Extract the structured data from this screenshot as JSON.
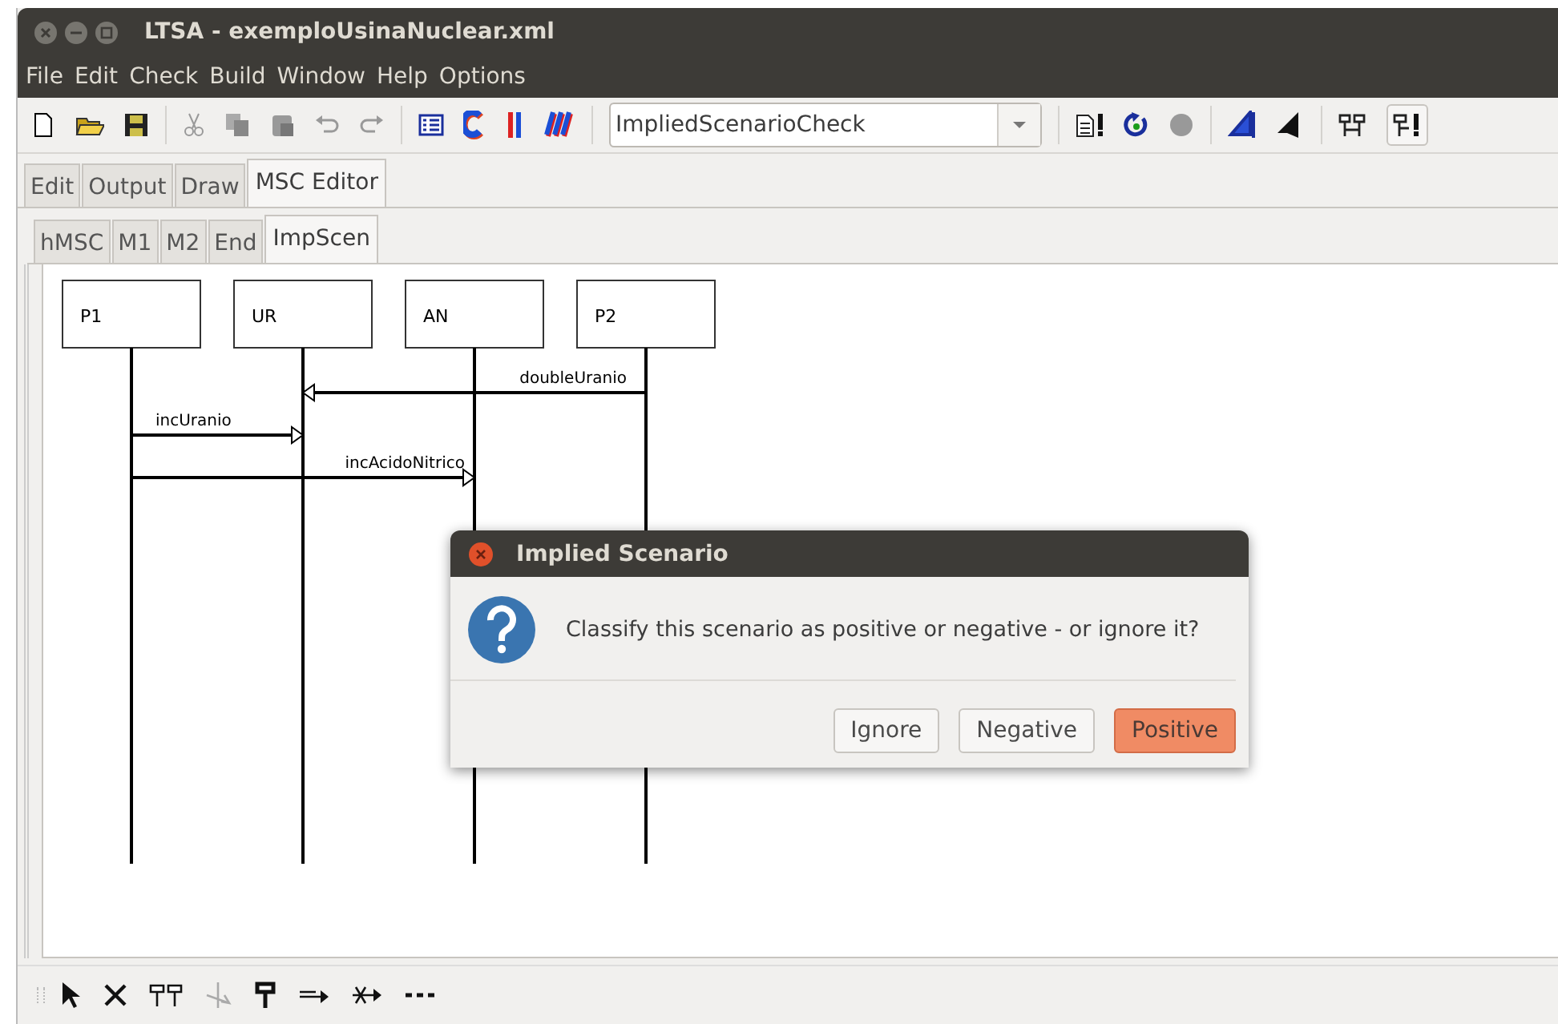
{
  "window": {
    "title": "LTSA - exemploUsinaNuclear.xml"
  },
  "menu": [
    "File",
    "Edit",
    "Check",
    "Build",
    "Window",
    "Help",
    "Options"
  ],
  "toolbar": {
    "target": "ImpliedScenarioCheck"
  },
  "tabs": [
    {
      "label": "Edit",
      "selected": false
    },
    {
      "label": "Output",
      "selected": false
    },
    {
      "label": "Draw",
      "selected": false
    },
    {
      "label": "MSC Editor",
      "selected": true
    }
  ],
  "subtabs": [
    {
      "label": "hMSC",
      "selected": false
    },
    {
      "label": "M1",
      "selected": false
    },
    {
      "label": "M2",
      "selected": false
    },
    {
      "label": "End",
      "selected": false
    },
    {
      "label": "ImpScen",
      "selected": true
    }
  ],
  "diagram": {
    "instances": [
      "P1",
      "UR",
      "AN",
      "P2"
    ],
    "messages": [
      {
        "label": "doubleUranio"
      },
      {
        "label": "incUranio"
      },
      {
        "label": "incAcidoNitrico"
      }
    ]
  },
  "dialog": {
    "title": "Implied Scenario",
    "message": "Classify this scenario as positive or negative - or ignore it?",
    "buttons": [
      {
        "label": "Ignore",
        "default": false
      },
      {
        "label": "Negative",
        "default": false
      },
      {
        "label": "Positive",
        "default": true
      }
    ]
  }
}
